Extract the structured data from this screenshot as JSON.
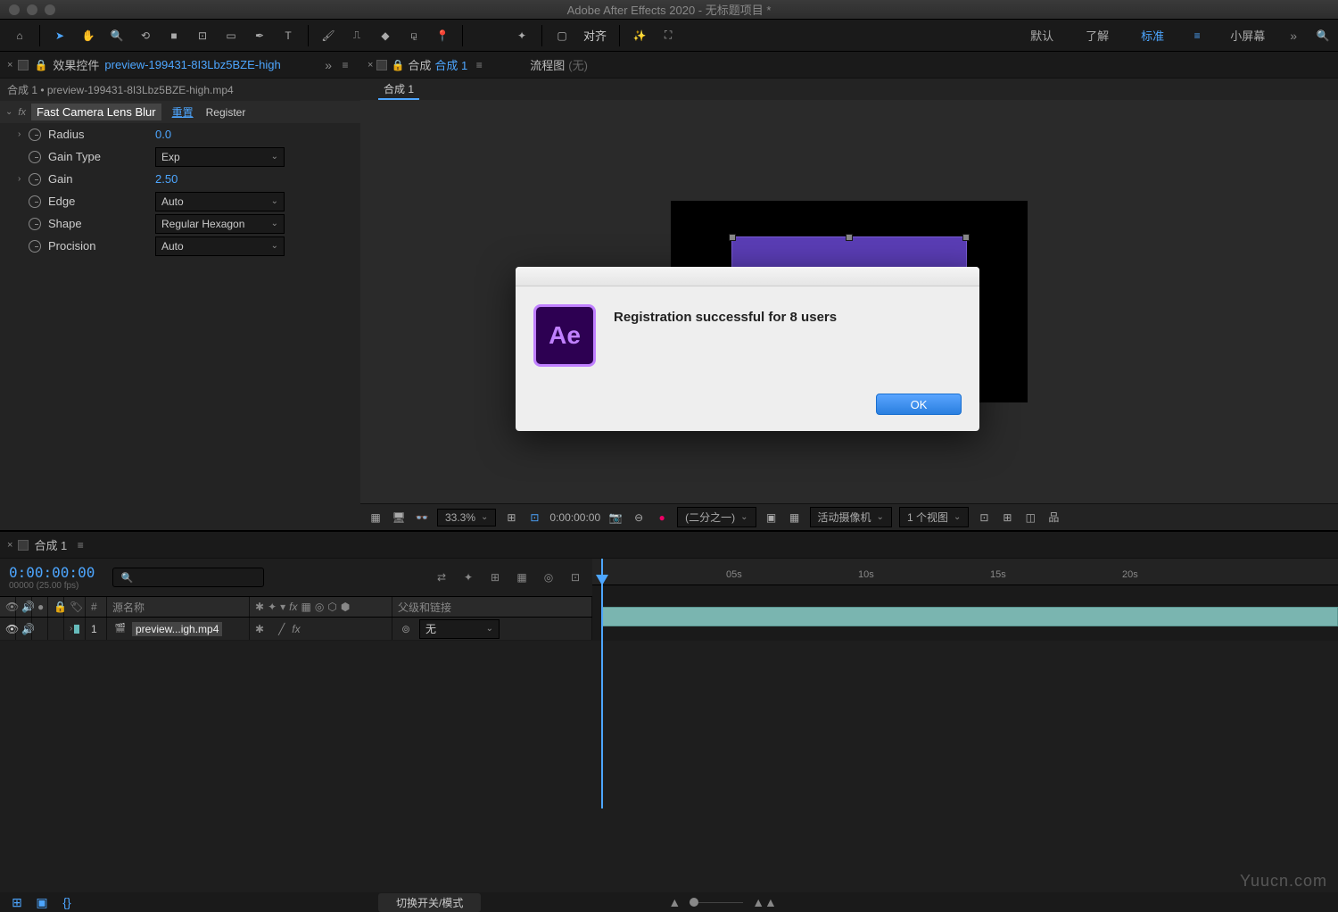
{
  "app": {
    "title": "Adobe After Effects 2020 - 无标题项目 *"
  },
  "toolbar": {
    "align_label": "对齐",
    "workspaces": {
      "default": "默认",
      "learn": "了解",
      "standard": "标准",
      "small_screen": "小屏幕"
    }
  },
  "effects_panel": {
    "tab_prefix": "效果控件",
    "tab_file": "preview-199431-8I3Lbz5BZE-high",
    "breadcrumb": "合成 1 • preview-199431-8I3Lbz5BZE-high.mp4",
    "effect_name": "Fast Camera Lens Blur",
    "reset": "重置",
    "register": "Register",
    "props": {
      "radius": {
        "label": "Radius",
        "value": "0.0"
      },
      "gain_type": {
        "label": "Gain Type",
        "value": "Exp"
      },
      "gain": {
        "label": "Gain",
        "value": "2.50"
      },
      "edge": {
        "label": "Edge",
        "value": "Auto"
      },
      "shape": {
        "label": "Shape",
        "value": "Regular Hexagon"
      },
      "procision": {
        "label": "Procision",
        "value": "Auto"
      }
    }
  },
  "viewer": {
    "tab_prefix": "合成",
    "tab_name": "合成 1",
    "flow_label": "流程图",
    "flow_none": "(无)",
    "subtab": "合成 1",
    "footer": {
      "zoom": "33.3%",
      "timecode": "0:00:00:00",
      "resolution": "(二分之一)",
      "camera": "活动摄像机",
      "views": "1 个视图"
    }
  },
  "timeline": {
    "tab": "合成 1",
    "timecode": "0:00:00:00",
    "fps": "00000 (25.00 fps)",
    "columns": {
      "source_name": "源名称",
      "parent": "父级和链接"
    },
    "ticks": [
      "05s",
      "10s",
      "15s",
      "20s"
    ],
    "layer": {
      "index": "1",
      "name": "preview...igh.mp4",
      "parent": "无"
    },
    "toggle_mode": "切换开关/模式"
  },
  "dialog": {
    "icon_text": "Ae",
    "message": "Registration successful for 8 users",
    "ok": "OK"
  },
  "watermark": "Yuucn.com"
}
